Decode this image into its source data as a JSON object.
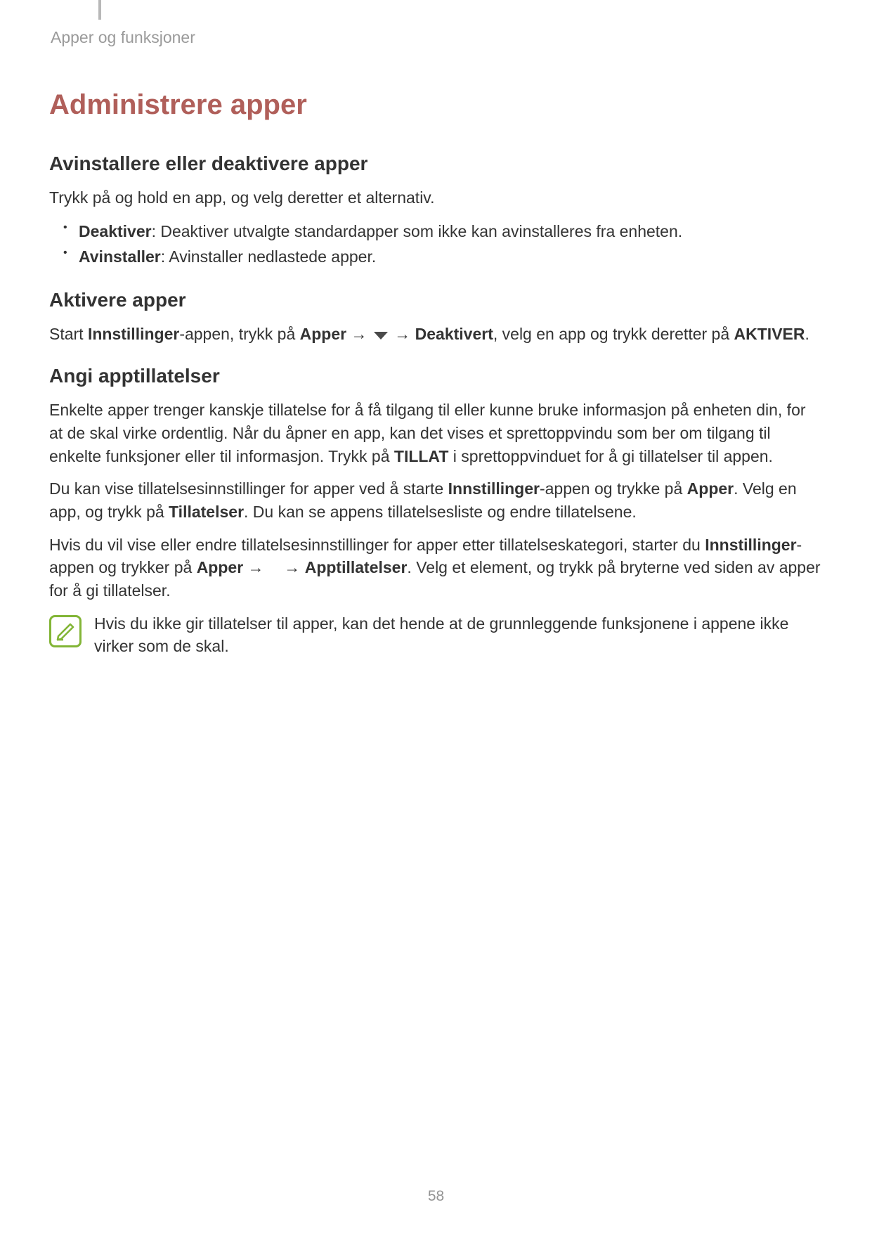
{
  "breadcrumb": "Apper og funksjoner",
  "h1": "Administrere apper",
  "section1": {
    "heading": "Avinstallere eller deaktivere apper",
    "intro": "Trykk på og hold en app, og velg deretter et alternativ.",
    "bullets": [
      {
        "label": "Deaktiver",
        "text": ": Deaktiver utvalgte standardapper som ikke kan avinstalleres fra enheten."
      },
      {
        "label": "Avinstaller",
        "text": ": Avinstaller nedlastede apper."
      }
    ]
  },
  "section2": {
    "heading": "Aktivere apper",
    "p_pre": "Start ",
    "p_b1": "Innstillinger",
    "p_mid1": "-appen, trykk på ",
    "p_b2": "Apper",
    "p_arrow1": " → ",
    "p_arrow2": " → ",
    "p_b3": "Deaktivert",
    "p_mid2": ", velg en app og trykk deretter på ",
    "p_b4": "AKTIVER",
    "p_end": "."
  },
  "section3": {
    "heading": "Angi apptillatelser",
    "p1_a": "Enkelte apper trenger kanskje tillatelse for å få tilgang til eller kunne bruke informasjon på enheten din, for at de skal virke ordentlig. Når du åpner en app, kan det vises et sprettoppvindu som ber om tilgang til enkelte funksjoner eller til informasjon. Trykk på ",
    "p1_b": "TILLAT",
    "p1_c": " i sprettoppvinduet for å gi tillatelser til appen.",
    "p2_a": "Du kan vise tillatelsesinnstillinger for apper ved å starte ",
    "p2_b1": "Innstillinger",
    "p2_c": "-appen og trykke på ",
    "p2_b2": "Apper",
    "p2_d": ". Velg en app, og trykk på ",
    "p2_b3": "Tillatelser",
    "p2_e": ". Du kan se appens tillatelsesliste og endre tillatelsene.",
    "p3_a": "Hvis du vil vise eller endre tillatelsesinnstillinger for apper etter tillatelseskategori, starter du ",
    "p3_b1": "Innstillinger",
    "p3_c": "-appen og trykker på ",
    "p3_b2": "Apper",
    "p3_arr1": " → ",
    "p3_arr2": " → ",
    "p3_b3": "Apptillatelser",
    "p3_d": ". Velg et element, og trykk på bryterne ved siden av apper for å gi tillatelser."
  },
  "note": "Hvis du ikke gir tillatelser til apper, kan det hende at de grunnleggende funksjonene i appene ikke virker som de skal.",
  "pageNumber": "58"
}
